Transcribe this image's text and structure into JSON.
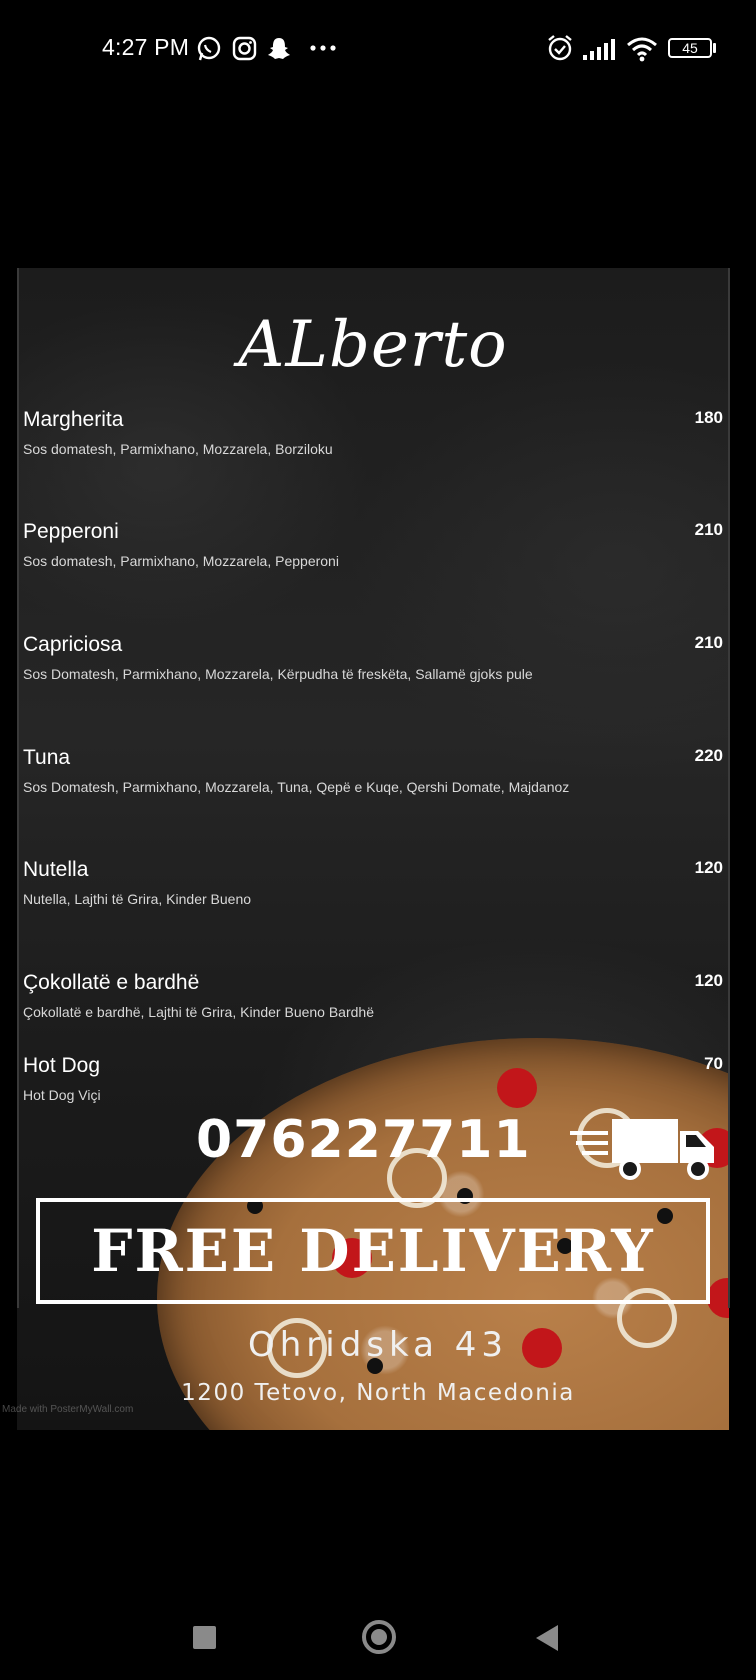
{
  "status_bar": {
    "time": "4:27 PM",
    "battery": "45",
    "icons_left": [
      "whatsapp-icon",
      "instagram-icon",
      "snapchat-icon",
      "more-dots-icon"
    ],
    "icons_right": [
      "alarm-icon",
      "signal-icon",
      "wifi-icon",
      "battery-icon"
    ]
  },
  "poster": {
    "brand": "ALberto",
    "items": [
      {
        "name": "Margherita",
        "price": "180",
        "desc": "Sos domatesh, Parmixhano, Mozzarela, Borziloku"
      },
      {
        "name": "Pepperoni",
        "price": "210",
        "desc": "Sos domatesh, Parmixhano, Mozzarela, Pepperoni"
      },
      {
        "name": "Capriciosa",
        "price": "210",
        "desc": "Sos Domatesh, Parmixhano, Mozzarela, Kërpudha të freskëta, Sallamë gjoks pule"
      },
      {
        "name": "Tuna",
        "price": "220",
        "desc": "Sos Domatesh, Parmixhano, Mozzarela, Tuna, Qepë e Kuqe, Qershi Domate, Majdanoz"
      },
      {
        "name": "Nutella",
        "price": "120",
        "desc": "Nutella, Lajthi të Grira, Kinder Bueno"
      },
      {
        "name": "Çokollatë e bardhë",
        "price": "120",
        "desc": "Çokollatë e bardhë, Lajthi të Grira, Kinder Bueno Bardhë"
      },
      {
        "name": "Hot Dog",
        "price": "70",
        "desc": "Hot Dog Viçi"
      }
    ],
    "phone": "076227711",
    "delivery": "FREE DELIVERY",
    "address_line1": "Ohridska 43",
    "address_line2": "1200 Tetovo, North Macedonia",
    "watermark": "Made with PosterMyWall.com"
  },
  "nav": {
    "icons": [
      "recent-apps-icon",
      "home-icon",
      "back-icon"
    ]
  }
}
